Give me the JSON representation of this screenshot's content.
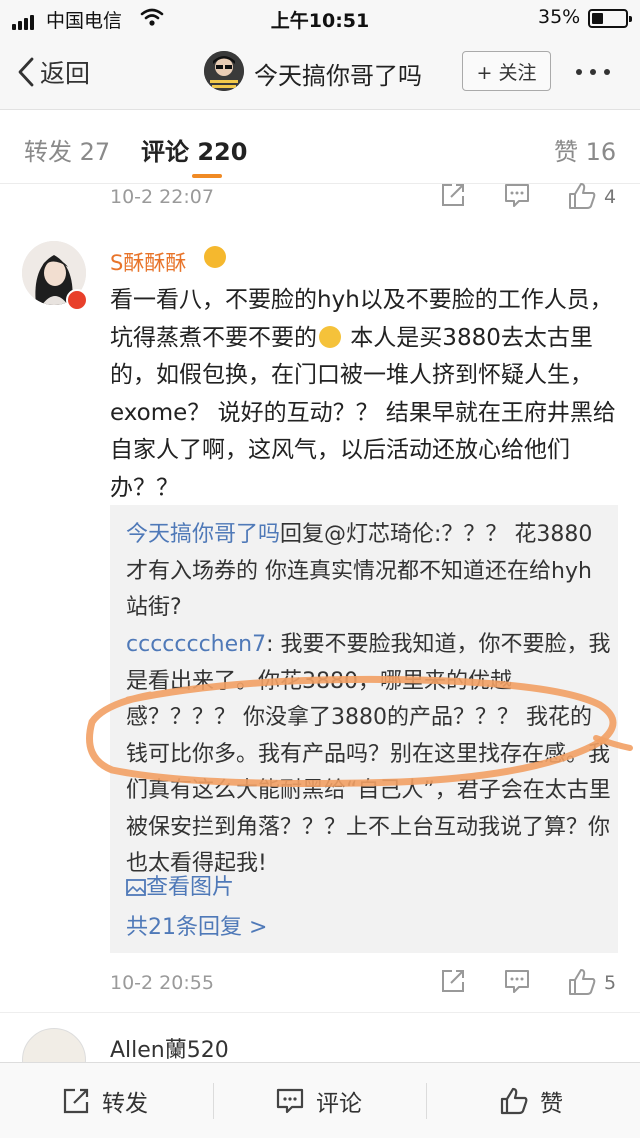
{
  "status_bar": {
    "carrier": "中国电信",
    "time": "上午10:51",
    "battery": "35%",
    "battery_level": 0.35
  },
  "nav": {
    "back_label": "返回",
    "title": "今天搞你哥了吗",
    "follow_label": "+ 关注"
  },
  "tabs": [
    {
      "label": "转发 27"
    },
    {
      "label": "评论 220"
    },
    {
      "label": "赞 16"
    }
  ],
  "prev_comment": {
    "time": "10-2 22:07",
    "likes": "4"
  },
  "comment": {
    "author": "S酥酥酥",
    "text_part1": "看一看八，不要脸的hyh以及不要脸的工作人员，坑得蒸煮不要不要的",
    "text_part2": " 本人是买3880去太古里的，如假包换，在门口被一堆人挤到怀疑人生，exome？ 说好的互动？？ 结果早就在王府井黑给自家人了啊，这风气，以后活动还放心给他们办？？",
    "replies": [
      {
        "user": "今天搞你哥了吗",
        "text": "回复@灯芯琦伦:？？？ 花3880才有入场券的 你连真实情况都不知道还在给hyh站街?"
      },
      {
        "user": "ccccccchen7",
        "text": ": 我要不要脸我知道，你不要脸，我是看出来了。你花3880，哪里来的优越感？？？？ 你没拿了3880的产品？？？ 我花的钱可比你多。我有产品吗？别在这里找存在感。我们真有这么大能耐黑给“自己人”，君子会在太古里被保安拦到角落？？？上不上台互动我说了算？你也太看得起我!"
      }
    ],
    "view_image": "查看图片",
    "more_replies": "共21条回复 >",
    "time": "10-2 20:55",
    "likes": "5"
  },
  "next_comment": {
    "author": "Allen蘭520"
  },
  "toolbar": {
    "repost": "转发",
    "comment": "评论",
    "like": "赞"
  },
  "colors": {
    "accent_orange": "#f08a24",
    "link_blue": "#4f79b8",
    "username_orange": "#e8742a",
    "annotation_orange": "#f2a064"
  },
  "icons": [
    "back-arrow-icon",
    "wifi-icon",
    "share-icon",
    "comment-icon",
    "like-icon",
    "more-icon",
    "image-icon"
  ]
}
